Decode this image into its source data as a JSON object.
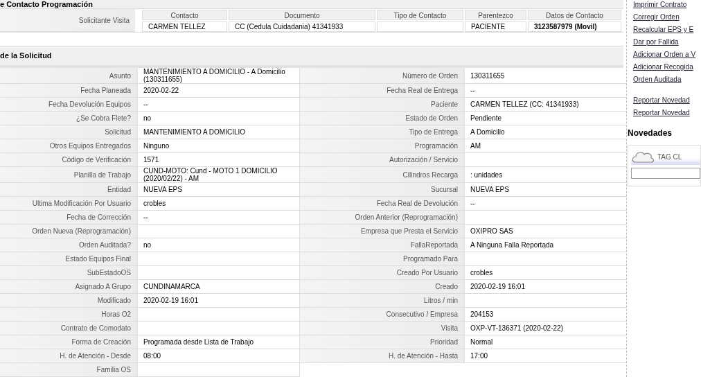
{
  "contact_section": {
    "title": "e Contacto Programación",
    "row_label": "Solicitante Visita",
    "columns": [
      "Contacto",
      "Documento",
      "Tipo de Contacto",
      "Parentezco",
      "Datos de Contacto"
    ],
    "row": {
      "contacto": "CARMEN TELLEZ",
      "documento": "CC (Cedula Cuidadania) 41341933",
      "parentezco": "PACIENTE",
      "datos_de_contacto": "3123587979 (Movil)"
    }
  },
  "details_section": {
    "title": "de la Solicitud",
    "rows": [
      {
        "left_label": "Asunto",
        "left_value": "MANTENIMIENTO A DOMICILIO - A Domicilio (130311655)",
        "right_label": "Número de Orden",
        "right_value": "130311655"
      },
      {
        "left_label": "Fecha Planeada",
        "left_value": "2020-02-22",
        "right_label": "Fecha Real de Entrega",
        "right_value": "--"
      },
      {
        "left_label": "Fecha Devolución Equipos",
        "left_value": "--",
        "right_label": "Paciente",
        "right_value": "CARMEN TELLEZ (CC: 41341933)"
      },
      {
        "left_label": "¿Se Cobra Flete?",
        "left_value": "no",
        "right_label": "Estado de Orden",
        "right_value": "Pendiente"
      },
      {
        "left_label": "Solicitud",
        "left_value": "MANTENIMIENTO A DOMICILIO",
        "right_label": "Tipo de Entrega",
        "right_value": "A Domicilio"
      },
      {
        "left_label": "Otros Equipos Entregados",
        "left_value": "Ninguno",
        "right_label": "Programación",
        "right_value": "AM"
      },
      {
        "left_label": "Código de Verificación",
        "left_value": "1571",
        "right_label": "Autorización / Servicio"
      },
      {
        "left_label": "Planilla de Trabajo",
        "left_value": "CUND-MOTO: Cund - MOTO 1 DOMICILIO (2020/02/22) - AM",
        "right_label": "Cilindros Recarga",
        "right_value": ": unidades"
      },
      {
        "left_label": "Entidad",
        "left_value": "NUEVA EPS",
        "right_label": "Sucursal",
        "right_value": "NUEVA EPS"
      },
      {
        "left_label": "Ultima Modificación Por Usuario",
        "left_value": "crobles",
        "right_label": "Fecha Real de Devolución",
        "right_value": "--"
      },
      {
        "left_label": "Fecha de Corrección",
        "left_value": "--",
        "right_label": "Orden Anterior (Reprogramación)"
      },
      {
        "left_label": "Orden Nueva (Reprogramación)",
        "right_label": "Empresa que Presta el Servicio",
        "right_value": "OXIPRO SAS"
      },
      {
        "left_label": "Orden Auditada?",
        "left_value": "no",
        "right_label": "FallaReportada",
        "right_value": "A Ninguna Falla Reportada"
      },
      {
        "left_label": "Estado Equipos Final",
        "right_label": "Programado Para"
      },
      {
        "left_label": "SubEstadoOS",
        "right_label": "Creado Por Usuario",
        "right_value": "crobles"
      },
      {
        "left_label": "Asignado A Grupo",
        "left_value": "CUNDINAMARCA",
        "right_label": "Creado",
        "right_value": "2020-02-19 16:01"
      },
      {
        "left_label": "Modificado",
        "left_value": "2020-02-19 16:01",
        "right_label": "Litros / min"
      },
      {
        "left_label": "Horas O2",
        "right_label": "Consecutivo / Empresa",
        "right_value": "204153"
      },
      {
        "left_label": "Contrato de Comodato",
        "right_label": "Visita",
        "right_value": "OXP-VT-136371 (2020-02-22)"
      },
      {
        "left_label": "Forma de Creación",
        "left_value": "Programada desde Lista de Trabajo",
        "right_label": "Prioridad",
        "right_value": "Normal"
      },
      {
        "left_label": "H. de Atención - Desde",
        "left_value": "08:00",
        "right_label": "H. de Atención - Hasta",
        "right_value": "17:00"
      },
      {
        "left_label": "Familia OS"
      }
    ]
  },
  "sidebar": {
    "links": [
      "Imprimir Contrato",
      "Corregir Orden",
      "Recalcular EPS y E",
      "Dar por Fallida",
      "Adicionar Orden a V",
      "Adicionar Recogida",
      "Orden Auditada",
      "Reportar Novedad",
      "Reportar Novedad"
    ],
    "novedades_title": "Novedades",
    "tag_cloud_label": "TAG CL"
  }
}
